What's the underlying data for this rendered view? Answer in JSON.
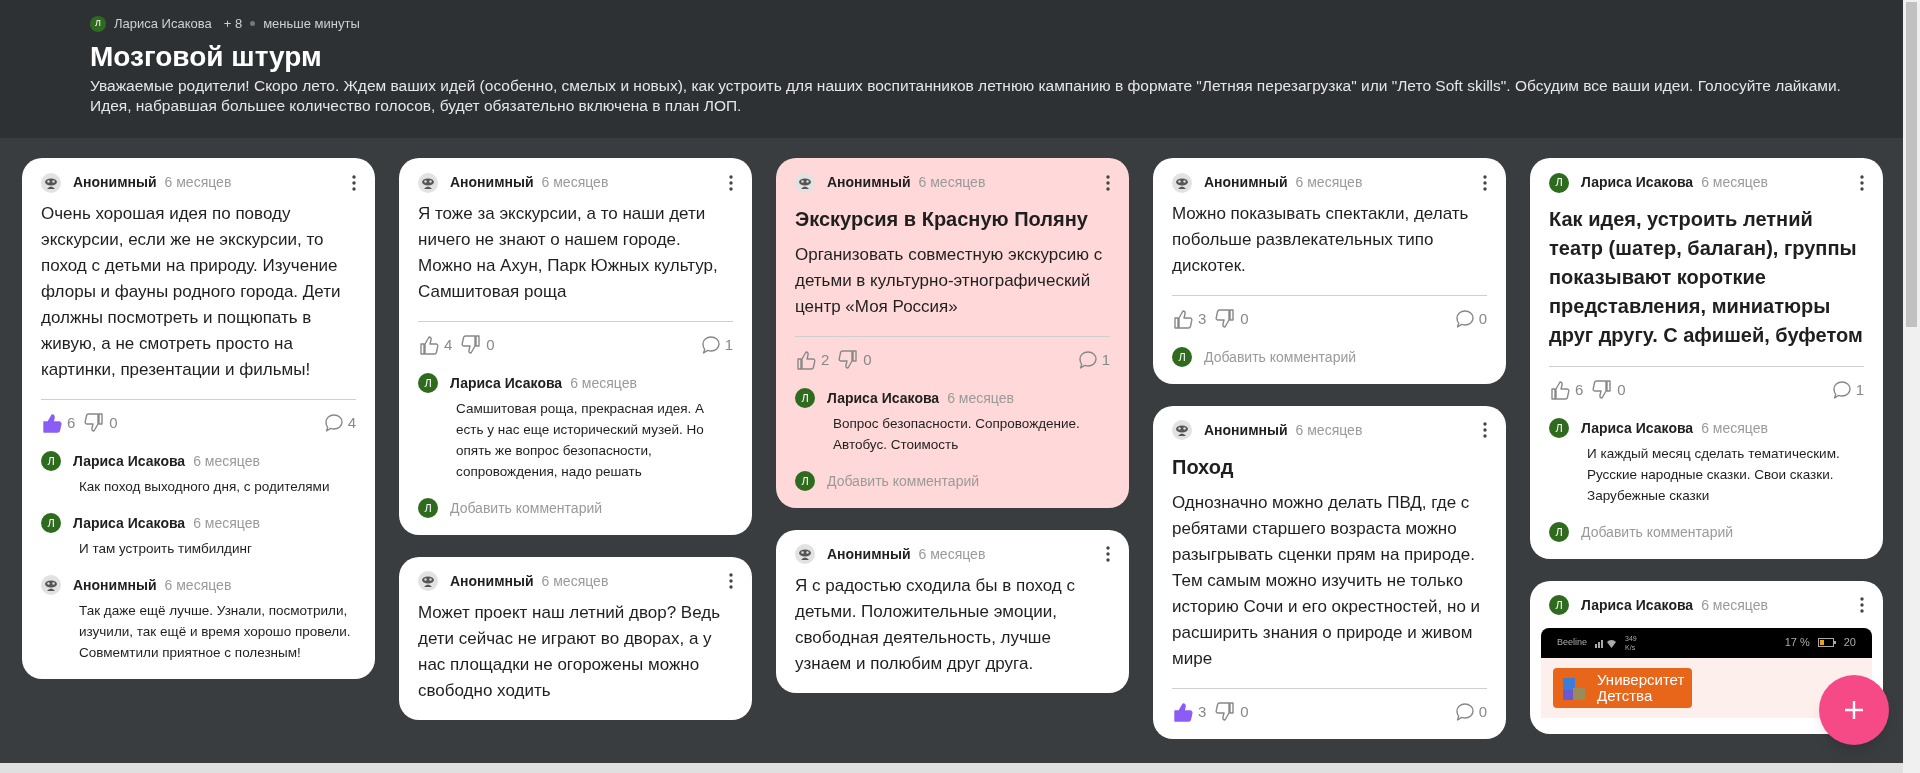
{
  "board": {
    "author": {
      "name": "Лариса Исакова",
      "initial": "Л"
    },
    "contributors": "+ 8",
    "updated": "меньше минуты",
    "title": "Мозговой штурм",
    "description": "Уважаемые родители! Скоро лето. Ждем ваших идей (особенно, смелых и новых), как устроить для наших воспитанников летнюю кампанию в формате \"Летняя перезагрузка\" или \"Лето Soft skills\". Обсудим все ваши идеи. Голосуйте лайками. Идея, набравшая большее количество голосов, будет обязательно включена в план ЛОП."
  },
  "columns": [
    {
      "cards": [
        {
          "color": "#ffffff",
          "author": {
            "kind": "anonymous",
            "name": "Анонимный"
          },
          "time": "6 месяцев",
          "body": "Очень хорошая идея по поводу экскурсии, если же не экскурсии, то поход с детьми на природу. Изучение флоры и фауны родного города. Дети должны посмотреть и пощюпать в живую, а не смотреть просто на картинки, презентации и фильмы!",
          "reactions": {
            "likes": "6",
            "liked": true,
            "dislikes": "0",
            "comments": "4"
          },
          "comments": [
            {
              "author": {
                "kind": "letter",
                "initial": "Л",
                "name": "Лариса Исакова"
              },
              "time": "6 месяцев",
              "text": "Как поход выходного дня, с родителями"
            },
            {
              "author": {
                "kind": "letter",
                "initial": "Л",
                "name": "Лариса Исакова"
              },
              "time": "6 месяцев",
              "text": "И там устроить тимбилдинг"
            },
            {
              "author": {
                "kind": "anonymous",
                "name": "Анонимный"
              },
              "time": "6 месяцев",
              "text": "Так даже ещё лучше. Узнали, посмотрили, изучили, так ещё и время хорошо провели. Совмемтили приятное с полезным!"
            }
          ]
        }
      ]
    },
    {
      "cards": [
        {
          "color": "#ffffff",
          "author": {
            "kind": "anonymous",
            "name": "Анонимный"
          },
          "time": "6 месяцев",
          "body": "Я тоже за экскурсии, а то наши дети ничего не знают о нашем городе. Можно на Ахун, Парк Южных культур, Самшитовая роща",
          "reactions": {
            "likes": "4",
            "liked": false,
            "dislikes": "0",
            "comments": "1"
          },
          "comments": [
            {
              "author": {
                "kind": "letter",
                "initial": "Л",
                "name": "Лариса Исакова"
              },
              "time": "6 месяцев",
              "text": "Самшитовая роща, прекрасная идея. А есть у нас еще исторический музей. Но опять же вопрос безопасности, сопровождения, надо решать"
            }
          ],
          "add_comment": {
            "initial": "Л",
            "placeholder": "Добавить комментарий"
          }
        },
        {
          "color": "#ffffff",
          "author": {
            "kind": "anonymous",
            "name": "Анонимный"
          },
          "time": "6 месяцев",
          "body": "Может проект наш летний двор? Ведь дети сейчас не играют во дворах, а у нас площадки не огорожены можно свободно ходить"
        }
      ]
    },
    {
      "cards": [
        {
          "color": "#ffd9d9",
          "author": {
            "kind": "anonymous",
            "name": "Анонимный"
          },
          "time": "6 месяцев",
          "title": "Экскурсия в Красную Поляну",
          "body": "Организовать совместную экскурсию с детьми в культурно-этнографический центр «Моя Россия»",
          "reactions": {
            "likes": "2",
            "liked": false,
            "dislikes": "0",
            "comments": "1"
          },
          "comments": [
            {
              "author": {
                "kind": "letter",
                "initial": "Л",
                "name": "Лариса Исакова"
              },
              "time": "6 месяцев",
              "text": "Вопрос безопасности. Сопровождение. Автобус. Стоимость"
            }
          ],
          "add_comment": {
            "initial": "Л",
            "placeholder": "Добавить комментарий"
          }
        },
        {
          "color": "#ffffff",
          "author": {
            "kind": "anonymous",
            "name": "Анонимный"
          },
          "time": "6 месяцев",
          "body": "Я с радостью сходила бы в поход с детьми. Положительные эмоции, свободная деятельность, лучше узнаем и  полюбим друг друга."
        }
      ]
    },
    {
      "cards": [
        {
          "color": "#ffffff",
          "author": {
            "kind": "anonymous",
            "name": "Анонимный"
          },
          "time": "6 месяцев",
          "body": "Можно показывать спектакли, делать побольше развлекательных типо дискотек.",
          "reactions": {
            "likes": "3",
            "liked": false,
            "dislikes": "0",
            "comments": "0"
          },
          "add_comment": {
            "initial": "Л",
            "placeholder": "Добавить комментарий"
          }
        },
        {
          "color": "#ffffff",
          "author": {
            "kind": "anonymous",
            "name": "Анонимный"
          },
          "time": "6 месяцев",
          "title": "Поход",
          "body": "Однозначно можно делать ПВД, где с ребятами старшего возраста можно разыгрывать сценки прям на природе. Тем самым можно изучить не только историю Сочи и его окрестностей, но и расширить знания о природе и живом мире",
          "reactions": {
            "likes": "3",
            "liked": true,
            "dislikes": "0",
            "comments": "0"
          }
        }
      ]
    },
    {
      "cards": [
        {
          "color": "#ffffff",
          "author": {
            "kind": "letter",
            "initial": "Л",
            "name": "Лариса Исакова"
          },
          "time": "6 месяцев",
          "title": "Как идея, устроить летний театр (шатер, балаган), группы показывают короткие представления, миниатюры друг другу. С афишей, буфетом",
          "reactions": {
            "likes": "6",
            "liked": false,
            "dislikes": "0",
            "comments": "1"
          },
          "comments": [
            {
              "author": {
                "kind": "letter",
                "initial": "Л",
                "name": "Лариса Исакова"
              },
              "time": "6 месяцев",
              "text": "И каждый месяц сделать тематическим. Русские народные сказки. Свои сказки. Зарубежные сказки"
            }
          ],
          "add_comment": {
            "initial": "Л",
            "placeholder": "Добавить комментарий"
          }
        },
        {
          "color": "#ffffff",
          "author": {
            "kind": "letter",
            "initial": "Л",
            "name": "Лариса Исакова"
          },
          "time": "6 месяцев",
          "attachment": {
            "carrier": "Beeline",
            "speed": "349",
            "speed_unit": "K/s",
            "battery": "17 %",
            "clock": "20",
            "logo_lines": [
              "Университет",
              "Детства"
            ]
          }
        }
      ]
    }
  ]
}
